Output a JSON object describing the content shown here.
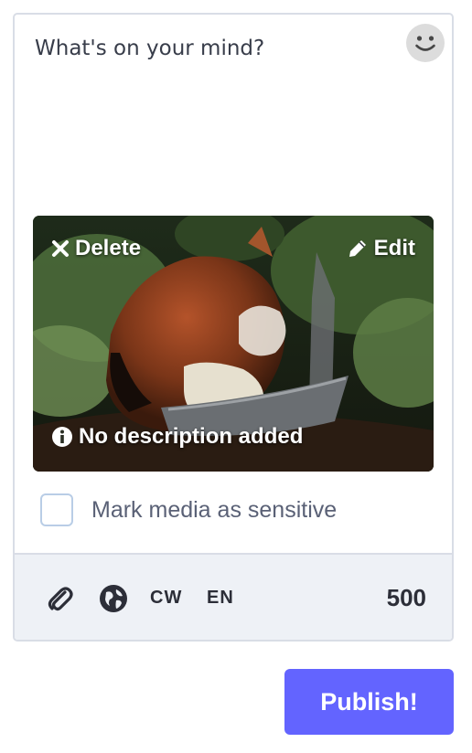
{
  "compose": {
    "placeholder": "What's on your mind?",
    "value": "",
    "emoji_icon": "smile-icon"
  },
  "media": {
    "delete_label": "Delete",
    "edit_label": "Edit",
    "description_status": "No description added",
    "icons": {
      "delete": "close-icon",
      "edit": "pencil-icon",
      "info": "info-icon"
    }
  },
  "sensitive": {
    "label": "Mark media as sensitive",
    "checked": false
  },
  "footer": {
    "attach_icon": "paperclip-icon",
    "visibility_icon": "globe-icon",
    "cw_label": "CW",
    "language_label": "EN",
    "char_count": "500"
  },
  "publish_label": "Publish!",
  "colors": {
    "accent": "#6364ff",
    "border": "#d9dde6",
    "footer_bg": "#eef1f6",
    "text": "#2c2e38",
    "muted": "#5a6176"
  }
}
